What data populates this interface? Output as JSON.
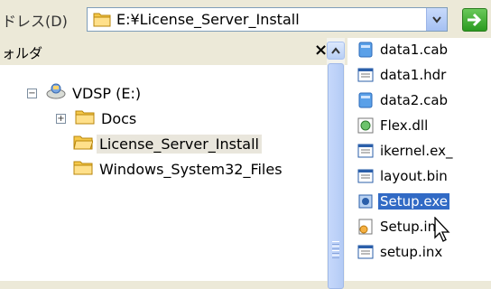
{
  "address": {
    "label": "ドレス(D)",
    "value": "E:¥License_Server_Install",
    "go_color": "#2a9a1f"
  },
  "tree": {
    "title": "ォルダ",
    "close": "×",
    "drive": {
      "label": "VDSP (E:)",
      "expander": "−"
    },
    "folders": [
      {
        "label": "Docs",
        "expander": "+"
      },
      {
        "label": "License_Server_Install"
      },
      {
        "label": "Windows_System32_Files"
      }
    ]
  },
  "files": [
    {
      "name": "data1.cab",
      "icon": "cab-icon"
    },
    {
      "name": "data1.hdr",
      "icon": "doc-icon"
    },
    {
      "name": "data2.cab",
      "icon": "cab-icon"
    },
    {
      "name": "Flex.dll",
      "icon": "dll-icon"
    },
    {
      "name": "ikernel.ex_",
      "icon": "doc-icon"
    },
    {
      "name": "layout.bin",
      "icon": "doc-icon"
    },
    {
      "name": "Setup.exe",
      "icon": "setup-icon"
    },
    {
      "name": "Setup.ini",
      "icon": "ini-icon"
    },
    {
      "name": "setup.inx",
      "icon": "doc-icon"
    }
  ],
  "colors": {
    "selection": "#316ac5",
    "folder": "#f5c84a"
  }
}
